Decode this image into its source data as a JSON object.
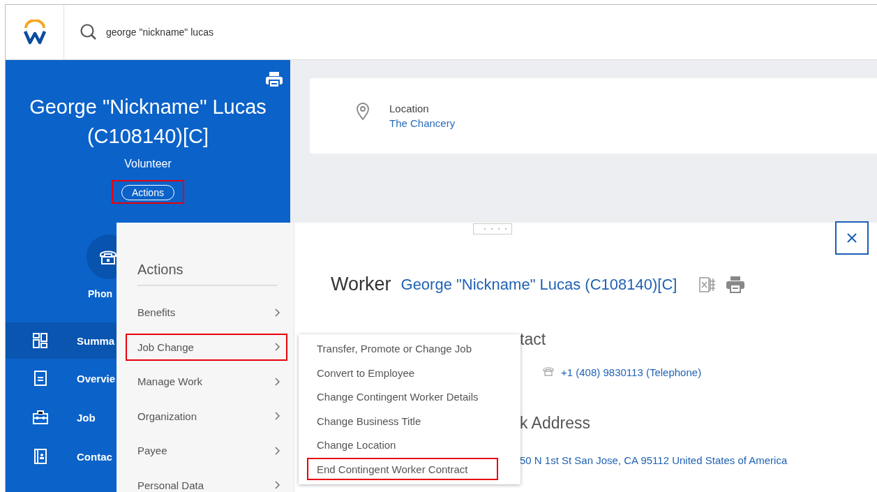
{
  "search": {
    "value": "george \"nickname\" lucas"
  },
  "profile": {
    "name": "George \"Nickname\" Lucas (C108140)[C]",
    "role": "Volunteer",
    "actions_button": {
      "label": "Actions",
      "highlighted": true
    }
  },
  "location_card": {
    "label": "Location",
    "value": "The Chancery"
  },
  "sidebar": {
    "phone_label": "Phon",
    "items": [
      {
        "label": "Summa",
        "kind": "summary",
        "selected": true
      },
      {
        "label": "Overvie",
        "kind": "overview",
        "selected": false
      },
      {
        "label": "Job",
        "kind": "job",
        "selected": false
      },
      {
        "label": "Contac",
        "kind": "contact",
        "selected": false
      }
    ]
  },
  "actions_menu": {
    "title": "Actions",
    "items": [
      {
        "label": "Benefits",
        "highlighted": false
      },
      {
        "label": "Job Change",
        "highlighted": true
      },
      {
        "label": "Manage Work",
        "highlighted": false
      },
      {
        "label": "Organization",
        "highlighted": false
      },
      {
        "label": "Payee",
        "highlighted": false
      },
      {
        "label": "Personal Data",
        "highlighted": false
      }
    ]
  },
  "submenu": {
    "items": [
      {
        "label": "Transfer, Promote or Change Job",
        "highlighted": false
      },
      {
        "label": "Convert to Employee",
        "highlighted": false
      },
      {
        "label": "Change Contingent Worker Details",
        "highlighted": false
      },
      {
        "label": "Change Business Title",
        "highlighted": false
      },
      {
        "label": "Change Location",
        "highlighted": false
      },
      {
        "label": "End Contingent Worker Contract",
        "highlighted": true
      }
    ]
  },
  "worker_panel": {
    "title": "Worker",
    "name": "George \"Nickname\" Lucas (C108140)[C]",
    "lines": [
      {
        "kind": "heading",
        "text": "tact"
      },
      {
        "kind": "phone",
        "text": "+1 (408) 9830113 (Telephone)"
      },
      {
        "kind": "heading",
        "text": "k Address"
      },
      {
        "kind": "link",
        "text": "50 N 1st St San Jose, CA 95112 United States of America"
      }
    ]
  }
}
